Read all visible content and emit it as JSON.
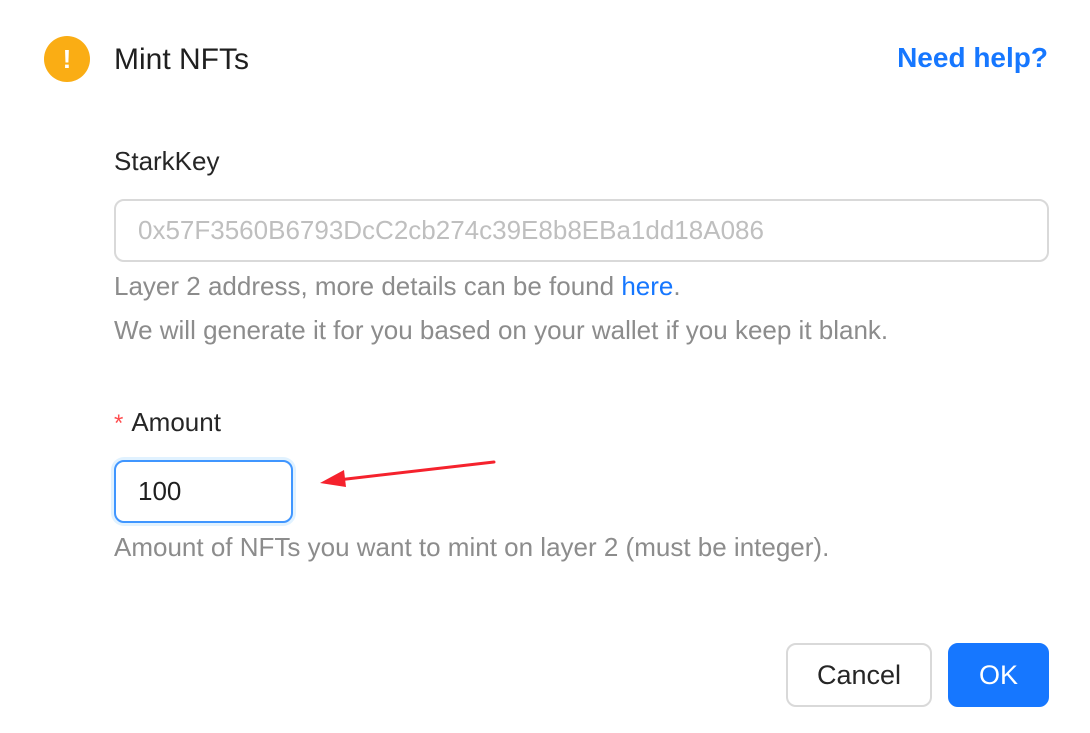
{
  "dialog": {
    "title": "Mint NFTs",
    "help_link": "Need help?",
    "icon": "exclamation-circle-icon",
    "icon_color": "#faad14",
    "accent_color": "#1677ff"
  },
  "starkkey": {
    "label": "StarkKey",
    "placeholder": "0x57F3560B6793DcC2cb274c39E8b8EBa1dd18A086",
    "value": "",
    "help_prefix": "Layer 2 address, more details can be found ",
    "help_link": "here",
    "help_suffix": ".",
    "help_line2": "We will generate it for you based on your wallet if you keep it blank."
  },
  "amount": {
    "required_mark": "*",
    "label": "Amount",
    "value": "100",
    "help": "Amount of NFTs you want to mint on layer 2 (must be integer)."
  },
  "footer": {
    "cancel_label": "Cancel",
    "ok_label": "OK"
  },
  "annotation": {
    "arrow_color": "#f5222d"
  }
}
